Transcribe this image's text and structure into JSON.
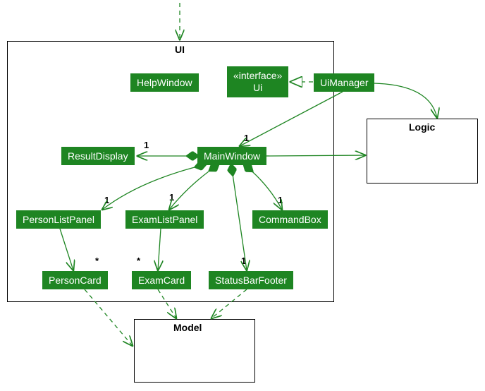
{
  "packages": {
    "ui": "UI",
    "logic": "Logic",
    "model": "Model"
  },
  "classes": {
    "helpWindow": "HelpWindow",
    "uiInterface": {
      "stereo": "«interface»",
      "name": "Ui"
    },
    "uiManager": "UiManager",
    "resultDisplay": "ResultDisplay",
    "mainWindow": "MainWindow",
    "personListPanel": "PersonListPanel",
    "examListPanel": "ExamListPanel",
    "commandBox": "CommandBox",
    "personCard": "PersonCard",
    "examCard": "ExamCard",
    "statusBarFooter": "StatusBarFooter"
  },
  "mult": {
    "one": "1",
    "many": "*"
  },
  "chart_data": {
    "type": "uml-class-diagram",
    "packages": [
      {
        "name": "UI",
        "contains": [
          "HelpWindow",
          "Ui",
          "UiManager",
          "ResultDisplay",
          "MainWindow",
          "PersonListPanel",
          "ExamListPanel",
          "CommandBox",
          "PersonCard",
          "ExamCard",
          "StatusBarFooter"
        ]
      },
      {
        "name": "Logic",
        "contains": []
      },
      {
        "name": "Model",
        "contains": []
      }
    ],
    "classes": [
      {
        "name": "Ui",
        "stereotype": "interface"
      },
      {
        "name": "UiManager"
      },
      {
        "name": "HelpWindow"
      },
      {
        "name": "MainWindow"
      },
      {
        "name": "ResultDisplay"
      },
      {
        "name": "PersonListPanel"
      },
      {
        "name": "ExamListPanel"
      },
      {
        "name": "CommandBox"
      },
      {
        "name": "StatusBarFooter"
      },
      {
        "name": "PersonCard"
      },
      {
        "name": "ExamCard"
      }
    ],
    "relations": [
      {
        "from": "(external)",
        "to": "UI",
        "type": "dependency"
      },
      {
        "from": "UiManager",
        "to": "Ui",
        "type": "realization"
      },
      {
        "from": "UiManager",
        "to": "MainWindow",
        "type": "association",
        "multiplicity": "1"
      },
      {
        "from": "UiManager",
        "to": "Logic",
        "type": "association"
      },
      {
        "from": "MainWindow",
        "to": "ResultDisplay",
        "type": "composition",
        "multiplicity": "1"
      },
      {
        "from": "MainWindow",
        "to": "PersonListPanel",
        "type": "composition",
        "multiplicity": "1"
      },
      {
        "from": "MainWindow",
        "to": "ExamListPanel",
        "type": "composition",
        "multiplicity": "1"
      },
      {
        "from": "MainWindow",
        "to": "CommandBox",
        "type": "composition",
        "multiplicity": "1"
      },
      {
        "from": "MainWindow",
        "to": "StatusBarFooter",
        "type": "composition",
        "multiplicity": "1"
      },
      {
        "from": "MainWindow",
        "to": "Logic",
        "type": "association"
      },
      {
        "from": "PersonListPanel",
        "to": "PersonCard",
        "type": "association",
        "multiplicity": "*"
      },
      {
        "from": "ExamListPanel",
        "to": "ExamCard",
        "type": "association",
        "multiplicity": "*"
      },
      {
        "from": "PersonCard",
        "to": "Model",
        "type": "dependency"
      },
      {
        "from": "ExamCard",
        "to": "Model",
        "type": "dependency"
      },
      {
        "from": "StatusBarFooter",
        "to": "Model",
        "type": "dependency"
      }
    ]
  }
}
